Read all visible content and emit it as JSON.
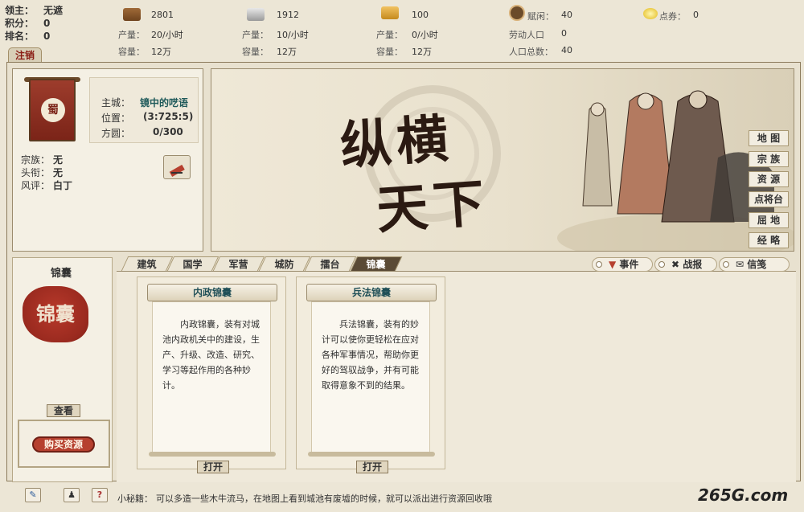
{
  "lord": {
    "lord_key": "领主：",
    "lord_val": "无遮",
    "score_key": "积分：",
    "score_val": "0",
    "rank_key": "排名：",
    "rank_val": "0"
  },
  "logout_label": "注销",
  "resources": [
    {
      "icon": "wood-icon",
      "value": "2801",
      "prod_label": "产量：",
      "prod": "20/小时",
      "cap_label": "容量：",
      "cap": "12万"
    },
    {
      "icon": "iron-icon",
      "value": "1912",
      "prod_label": "产量：",
      "prod": "10/小时",
      "cap_label": "容量：",
      "cap": "12万"
    },
    {
      "icon": "grain-icon",
      "value": "100",
      "prod_label": "产量：",
      "prod": "0/小时",
      "cap_label": "容量：",
      "cap": "12万"
    }
  ],
  "population": {
    "idle_label": "赋闲：",
    "idle": "40",
    "labor_label": "劳动人口",
    "labor": "0",
    "total_label": "人口总数：",
    "total": "40"
  },
  "coupon": {
    "label": "点券：",
    "value": "0"
  },
  "profile": {
    "flag_char": "蜀",
    "city_key": "主城：",
    "city_val": "镜中的呓语",
    "pos_key": "位置：",
    "pos_val": "(3:725:5)",
    "area_key": "方圆：",
    "area_val": "0/300",
    "clan_key": "宗族：",
    "clan_val": "无",
    "title_key": "头衔：",
    "title_val": "无",
    "rep_key": "风评：",
    "rep_val": "白丁"
  },
  "banner": {
    "title_line1": "纵横",
    "title_line2": "天下",
    "side_buttons": [
      "地 图",
      "宗 族",
      "资 源",
      "点将台",
      "屈 地",
      "经 略"
    ]
  },
  "bag": {
    "title": "锦囊",
    "seal_text": "锦囊",
    "view_label": "查看",
    "buy_label": "购买资源"
  },
  "tabs": [
    "建筑",
    "国学",
    "军营",
    "城防",
    "擂台",
    "锦囊"
  ],
  "active_tab": "锦囊",
  "event_tabs": [
    "事件",
    "战报",
    "信笺"
  ],
  "cards": [
    {
      "title": "内政锦囊",
      "body": "内政锦囊，装有对城池内政机关中的建设，生产、升级、改造、研究、学习等起作用的各种妙计。",
      "open_label": "打开"
    },
    {
      "title": "兵法锦囊",
      "body": "兵法锦囊，装有的妙计可以使你更轻松在应对各种军事情况，帮助你更好的驾驭战争，并有可能取得意象不到的结果。",
      "open_label": "打开"
    }
  ],
  "bottom": {
    "tip_label": "小秘籍：",
    "tip_text": "可以多造一些木牛流马，在地图上看到城池有废墟的时候，就可以派出进行资源回收哦",
    "brand": "265G.com",
    "help_glyph": "?"
  },
  "colors": {
    "accent_red": "#b6402f",
    "frame": "#9b8c6e",
    "teal_text": "#1f5a5a"
  }
}
